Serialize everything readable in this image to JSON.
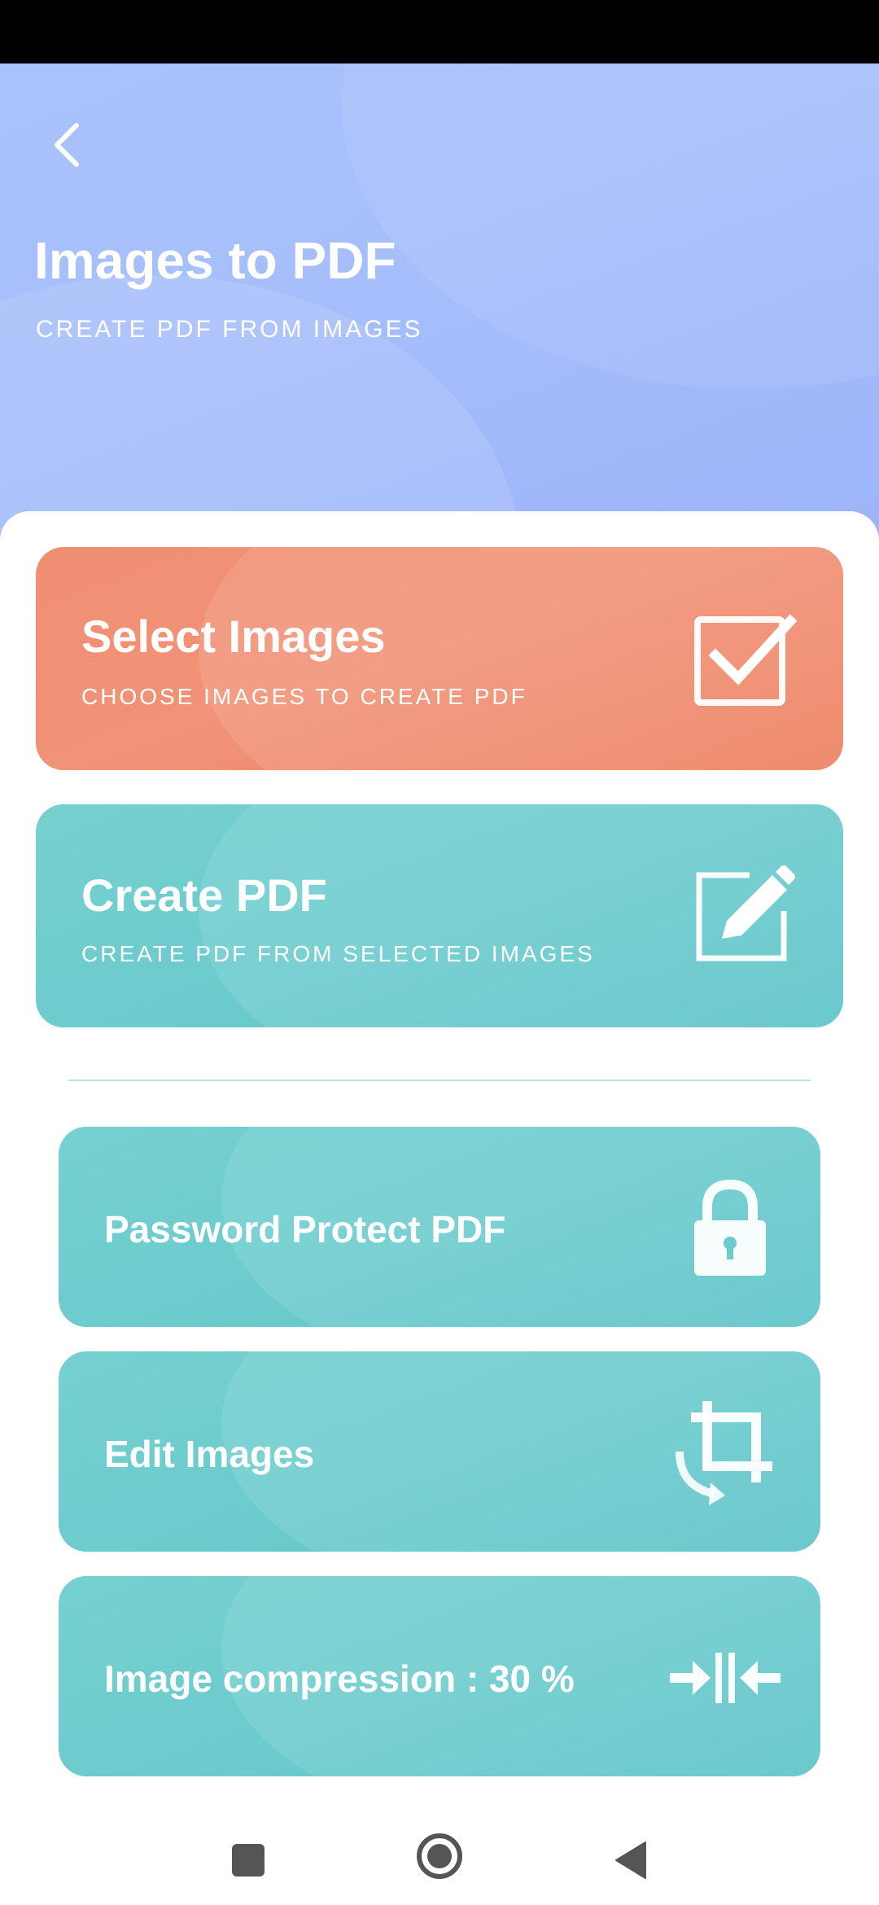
{
  "header": {
    "back_icon": "chevron-left-icon",
    "title": "Images to PDF",
    "subtitle": "CREATE PDF FROM IMAGES"
  },
  "primary_actions": [
    {
      "title": "Select Images",
      "subtitle": "CHOOSE IMAGES TO CREATE PDF",
      "icon": "checkbox-checked-icon",
      "color": "#f08e72"
    },
    {
      "title": "Create PDF",
      "subtitle": "CREATE PDF FROM SELECTED IMAGES",
      "icon": "edit-pencil-icon",
      "color": "#6ccbcd"
    }
  ],
  "options": [
    {
      "label": "Password Protect PDF",
      "icon": "lock-icon"
    },
    {
      "label": "Edit Images",
      "icon": "crop-rotate-icon"
    },
    {
      "label": "Image compression : 30 %",
      "icon": "compress-icon"
    }
  ],
  "colors": {
    "header_blue": "#a6bffb",
    "accent_orange": "#f08e72",
    "accent_teal": "#6ccbcd"
  },
  "system_nav": {
    "recents_icon": "square-icon",
    "home_icon": "circle-home-icon",
    "back_icon": "triangle-back-icon"
  }
}
